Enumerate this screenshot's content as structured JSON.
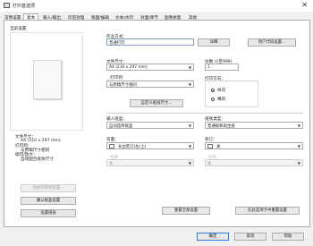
{
  "window": {
    "title": "打印首选项",
    "close_glyph": "✕"
  },
  "tabs": [
    "常用设置",
    "基本",
    "输入/输出",
    "印后处理",
    "版面/编辑",
    "文本/水印",
    "封面/章节",
    "图像质量",
    "其他"
  ],
  "left": {
    "preview_label": "当前设置",
    "paper_size_label": "文件尺寸：",
    "paper_size_value": "A4 (210 x 297 mm)",
    "print_label": "打印到：",
    "print_value": "与原稿尺寸相同",
    "scale_label": "缩印/放大：",
    "scale_value": "自动配合纸张尺寸",
    "add_favorite_button": "添加到常用设置...",
    "confirm_button": "确认纸盒设置",
    "device_button": "设置纸张"
  },
  "job": {
    "label": "作业方式：",
    "value": "普通打印",
    "details_button": "详细",
    "user_button": "用户代码设置..."
  },
  "doc_size": {
    "label": "文件尺寸：",
    "value": "A4 (210 x 297 mm)"
  },
  "print_to": {
    "label": "打印到：",
    "value": "与原稿尺寸相同"
  },
  "custom_button": "自定义纸张尺寸...",
  "copies": {
    "label": "份数 (1至999)",
    "value": "1"
  },
  "orientation": {
    "label": "打印方向：",
    "portrait": "纵向",
    "landscape": "横向"
  },
  "input_tray": {
    "label": "输入纸盒：",
    "value": "自动选择纸盒"
  },
  "paper_type": {
    "label": "纸张类型：",
    "value": "普通纸和再生纸"
  },
  "duplex": {
    "label": "双面：",
    "value": "长边装订(左/上)"
  },
  "staple": {
    "label": "装订：",
    "value": "关"
  },
  "combine": {
    "label": "合并",
    "value": "关"
  },
  "punch": {
    "label": "打孔：",
    "value": "关"
  },
  "restore_button": "重置全部设置",
  "restore_tab_button": "在此选项卡中重置设置",
  "footer": {
    "ok": "确定",
    "cancel": "取消",
    "help": "帮助"
  }
}
